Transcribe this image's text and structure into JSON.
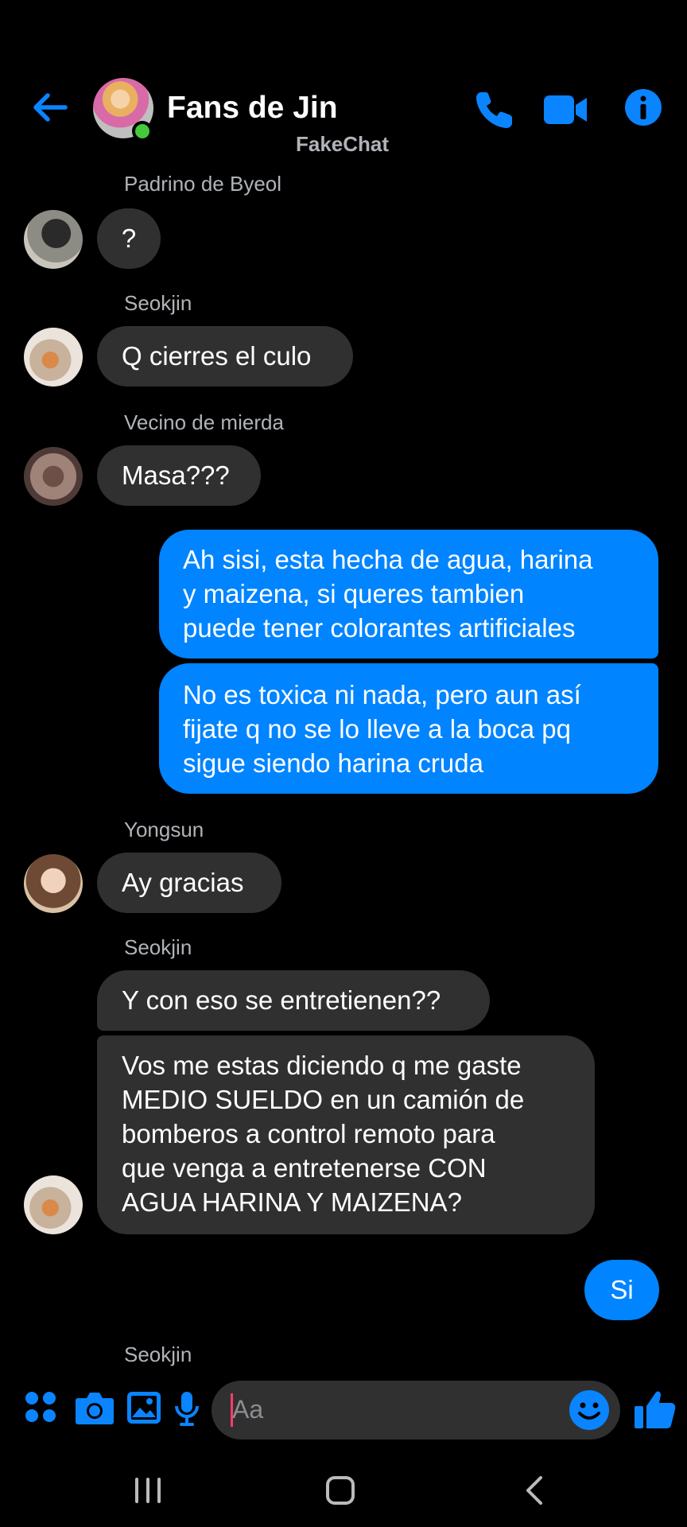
{
  "header": {
    "title": "Fans de Jin",
    "subtitle": "FakeChat"
  },
  "messages": [
    {
      "sender": "Padrino de Byeol",
      "text": "?"
    },
    {
      "sender": "Seokjin",
      "text": "Q cierres el culo"
    },
    {
      "sender": "Vecino de mierda",
      "text": "Masa???"
    },
    {
      "sender": "me",
      "lines": [
        "Ah sisi, esta hecha de agua, harina",
        "y maizena, si queres tambien",
        "puede tener colorantes artificiales"
      ]
    },
    {
      "sender": "me",
      "lines": [
        "No es toxica ni nada, pero aun así",
        "fijate q no se lo lleve a la boca pq",
        "sigue siendo harina cruda"
      ]
    },
    {
      "sender": "Yongsun",
      "text": "Ay gracias"
    },
    {
      "sender": "Seokjin",
      "text": "Y con eso se entretienen??"
    },
    {
      "sender": "Seokjin",
      "lines": [
        "Vos me estas diciendo q me gaste",
        "MEDIO SUELDO en un camión de",
        "bomberos a control remoto para",
        "que venga a entretenerse CON",
        "AGUA HARINA Y MAIZENA?"
      ]
    },
    {
      "sender": "me",
      "text": "Si"
    },
    {
      "sender": "Seokjin",
      "text": ""
    }
  ],
  "composer": {
    "placeholder": "Aa"
  },
  "colors": {
    "accent": "#0084ff",
    "incoming_bubble": "#303030",
    "online": "#45c83a"
  }
}
